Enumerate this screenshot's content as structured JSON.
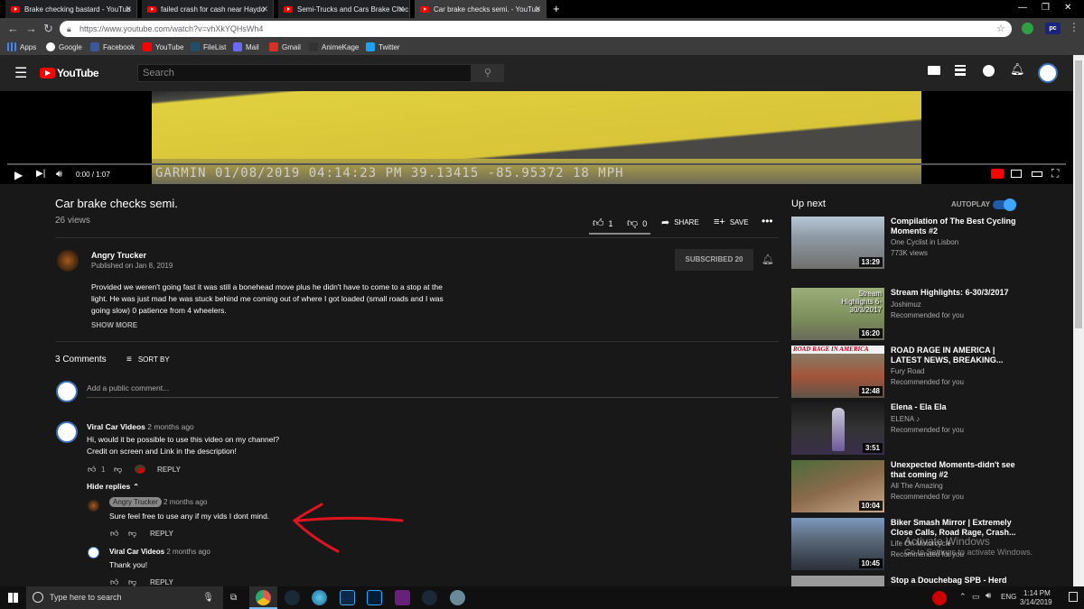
{
  "browser": {
    "tabs": [
      {
        "title": "Brake checking bastard - YouTub"
      },
      {
        "title": "failed crash for cash near Haydo"
      },
      {
        "title": "Semi-Trucks and Cars Brake Chec"
      },
      {
        "title": "Car brake checks semi. - YouTub"
      }
    ],
    "url": "https://www.youtube.com/watch?v=vhXkYQHsWh4",
    "bookmarks": [
      "Apps",
      "Google",
      "Facebook",
      "YouTube",
      "FileList",
      "Mail",
      "Gmail",
      "AnimeKage",
      "Twitter"
    ],
    "ext_label": "pc"
  },
  "youtube": {
    "logo": "YouTube",
    "search_placeholder": "Search",
    "video": {
      "overlay": "GARMIN 01/08/2019 04:14:23 PM 39.13415 -85.95372 18 MPH",
      "time": "0:00 / 1:07",
      "title": "Car brake checks semi.",
      "views": "26 views",
      "likes": "1",
      "dislikes": "0",
      "share": "SHARE",
      "save": "SAVE",
      "channel": "Angry Trucker",
      "published": "Published on Jan 8, 2019",
      "subscribe": "SUBSCRIBED 20",
      "description": "Provided we weren't going fast it was still a bonehead move plus he didn't have to come to a stop at the light. He was just mad he was stuck behind me coming out of where I got loaded (small roads and I was going slow) 0 patience from 4 wheelers.",
      "show_more": "SHOW MORE"
    },
    "comments": {
      "count": "3 Comments",
      "sort": "SORT BY",
      "add_placeholder": "Add a public comment...",
      "items": [
        {
          "author": "Viral Car Videos",
          "time": "2 months ago",
          "line1": "Hi, would it be possible to use this video on my channel?",
          "line2": "Credit on screen and Link in the description!",
          "likes": "1",
          "reply": "REPLY"
        },
        {
          "author": "Angry Trucker",
          "time": "2 months ago",
          "text": "Sure feel free to use any if my vids I dont mind.",
          "reply": "REPLY"
        },
        {
          "author": "Viral Car Videos",
          "time": "2 months ago",
          "text": "Thank you!",
          "reply": "REPLY"
        }
      ],
      "hide_replies": "Hide replies"
    },
    "up_next": {
      "label": "Up next",
      "autoplay": "AUTOPLAY",
      "videos": [
        {
          "title": "Compilation of The Best Cycling Moments #2",
          "channel": "One Cyclist in Lisbon",
          "meta": "773K views",
          "duration": "13:29"
        },
        {
          "title": "Stream Highlights: 6-30/3/2017",
          "channel": "Joshimuz",
          "meta": "Recommended for you",
          "duration": "16:20",
          "thumb_text": "Stream Highlights 6-30/3/2017"
        },
        {
          "title": "ROAD RAGE IN AMERICA | LATEST NEWS, BREAKING...",
          "channel": "Fury Road",
          "meta": "Recommended for you",
          "duration": "12:48",
          "thumb_text": "ROAD RAGE IN AMERICA"
        },
        {
          "title": "Elena - Ela Ela",
          "channel": "ELENA ♪",
          "meta": "Recommended for you",
          "duration": "3:51"
        },
        {
          "title": "Unexpected Moments-didn't see that coming #2",
          "channel": "All The Amazing",
          "meta": "Recommended for you",
          "duration": "10:04"
        },
        {
          "title": "Biker Smash Mirror | Extremely Close Calls, Road Rage, Crash...",
          "channel": "Life On Motorcycle",
          "meta": "Recommended for you",
          "duration": "10:45"
        },
        {
          "title": "Stop a Douchebag SPB - Herd"
        }
      ]
    },
    "watermark": {
      "line1": "Activate Windows",
      "line2": "Go to Settings to activate Windows."
    }
  },
  "taskbar": {
    "search_placeholder": "Type here to search",
    "lang": "ENG",
    "time": "1:14 PM",
    "date": "3/14/2019"
  },
  "colors": {
    "accent_red": "#ff0000",
    "link_blue": "#3ea6ff",
    "bg": "#181818"
  }
}
